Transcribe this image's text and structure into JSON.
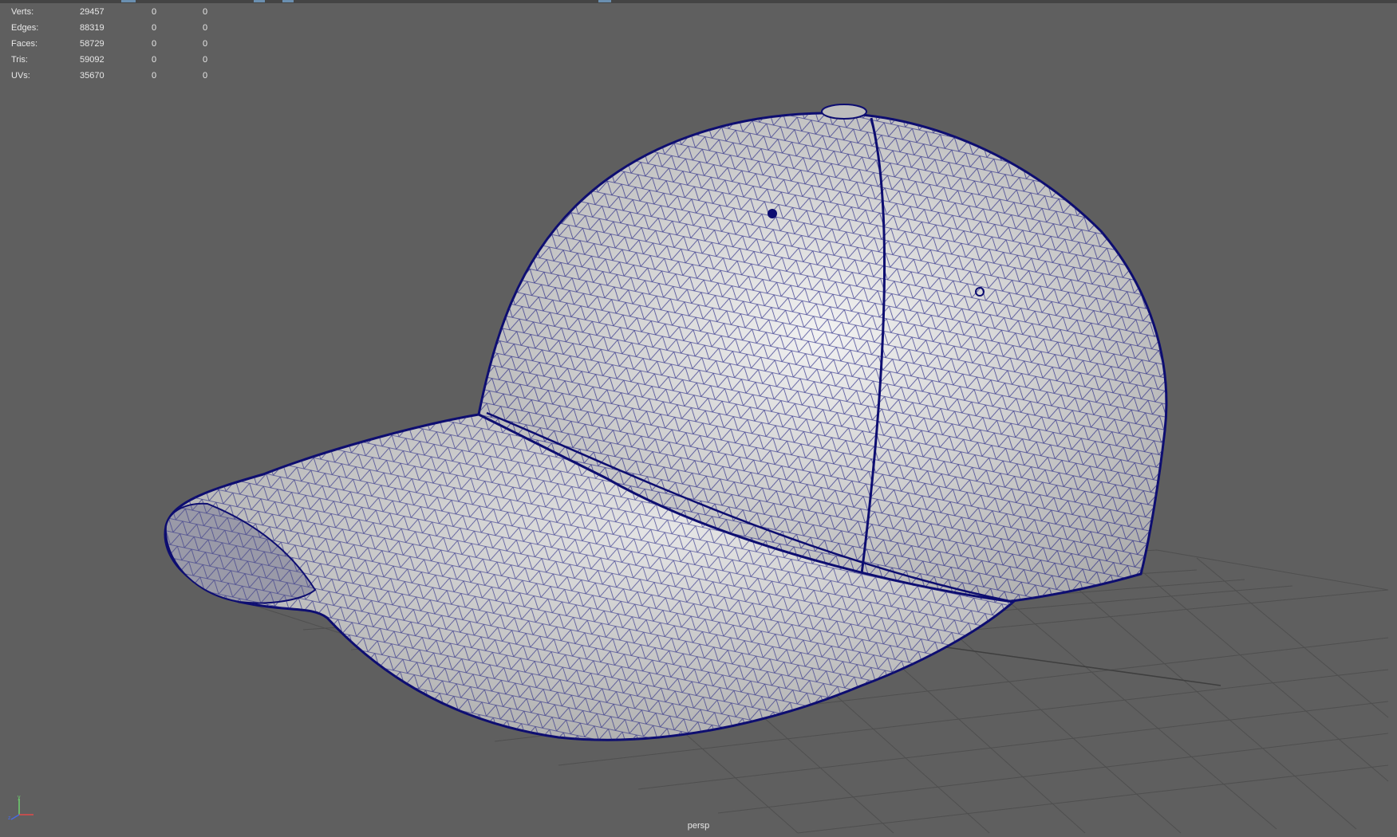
{
  "viewport": {
    "camera": "persp"
  },
  "stats": [
    {
      "label": "Verts:",
      "value": "29457",
      "sel": "0",
      "comp": "0"
    },
    {
      "label": "Edges:",
      "value": "88319",
      "sel": "0",
      "comp": "0"
    },
    {
      "label": "Faces:",
      "value": "58729",
      "sel": "0",
      "comp": "0"
    },
    {
      "label": "Tris:",
      "value": "59092",
      "sel": "0",
      "comp": "0"
    },
    {
      "label": "UVs:",
      "value": "35670",
      "sel": "0",
      "comp": "0"
    }
  ],
  "colors": {
    "background": "#5f5f5f",
    "wireframe": "#14147a",
    "grid": "#4e4e4e",
    "surface": "#d8d8d8"
  },
  "icons": {
    "axis": "xyz-axis-gizmo-icon"
  }
}
